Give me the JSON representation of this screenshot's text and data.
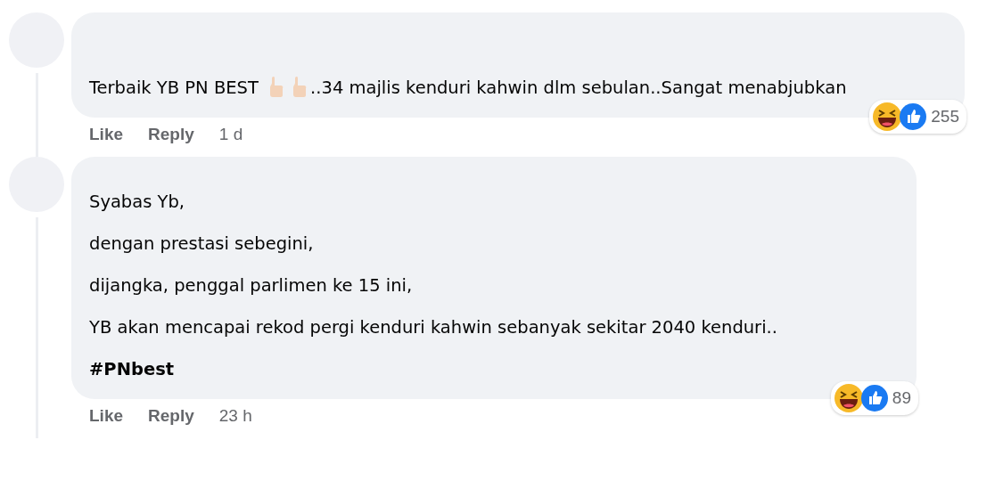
{
  "comments": [
    {
      "lines": [
        [
          {
            "kind": "text",
            "text": "Terbaik YB PN BEST "
          },
          {
            "kind": "thumbs"
          },
          {
            "kind": "thumbs"
          },
          {
            "kind": "text",
            "text": "..34 majlis kenduri kahwin dlm sebulan..Sangat menabjubkan"
          }
        ]
      ],
      "actions": [
        "Like",
        "Reply"
      ],
      "time": "1 d",
      "reaction_count": "255",
      "thread_line": true
    },
    {
      "lines": [
        [
          {
            "kind": "text",
            "text": "Syabas Yb,"
          }
        ],
        [
          {
            "kind": "text",
            "text": "dengan prestasi sebegini,"
          }
        ],
        [
          {
            "kind": "text",
            "text": "dijangka, penggal parlimen ke 15 ini,"
          }
        ],
        [
          {
            "kind": "text",
            "text": "YB akan mencapai rekod pergi kenduri kahwin sebanyak sekitar 2040 kenduri.."
          }
        ],
        [
          {
            "kind": "hashtag",
            "text": "#PNbest"
          }
        ]
      ],
      "actions": [
        "Like",
        "Reply"
      ],
      "time": "23 h",
      "reaction_count": "89",
      "thread_line": true
    }
  ]
}
